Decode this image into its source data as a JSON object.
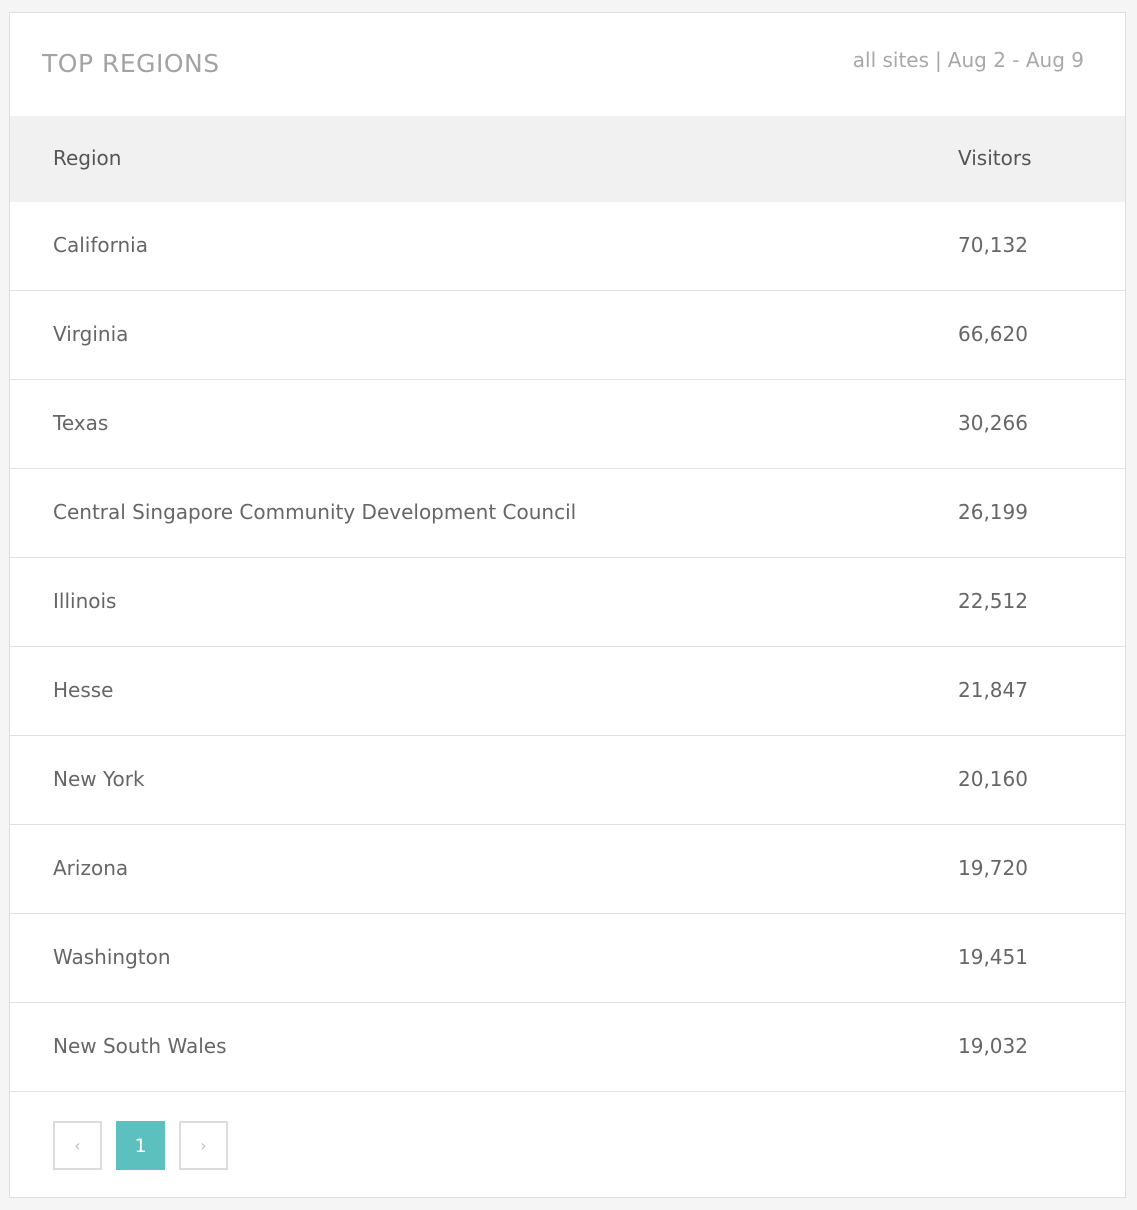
{
  "header": {
    "title": "TOP REGIONS",
    "scope": "all sites",
    "separator": "|",
    "date_range": "Aug 2 - Aug 9"
  },
  "table": {
    "columns": [
      "Region",
      "Visitors"
    ],
    "rows": [
      {
        "region": "California",
        "visitors": "70,132"
      },
      {
        "region": "Virginia",
        "visitors": "66,620"
      },
      {
        "region": "Texas",
        "visitors": "30,266"
      },
      {
        "region": "Central Singapore Community Development Council",
        "visitors": "26,199"
      },
      {
        "region": "Illinois",
        "visitors": "22,512"
      },
      {
        "region": "Hesse",
        "visitors": "21,847"
      },
      {
        "region": "New York",
        "visitors": "20,160"
      },
      {
        "region": "Arizona",
        "visitors": "19,720"
      },
      {
        "region": "Washington",
        "visitors": "19,451"
      },
      {
        "region": "New South Wales",
        "visitors": "19,032"
      }
    ]
  },
  "pagination": {
    "prev_icon": "chevron-left-icon",
    "prev_glyph": "‹",
    "current_page": "1",
    "next_icon": "chevron-right-icon",
    "next_glyph": "›"
  },
  "colors": {
    "accent": "#5bc0be",
    "header_bg": "#f1f1f1",
    "title_text": "#a3a3a3"
  }
}
